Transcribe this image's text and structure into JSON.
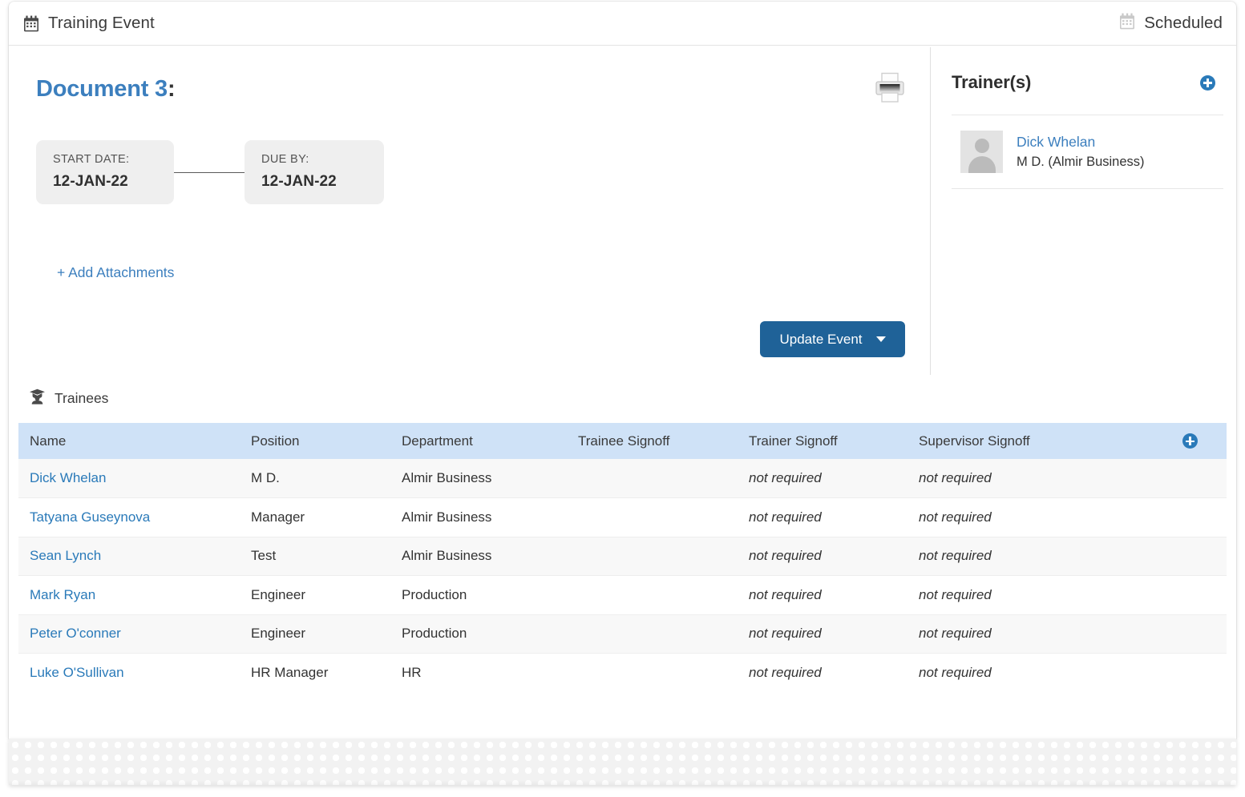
{
  "topbar": {
    "icon": "calendar-icon",
    "title": "Training Event",
    "status_icon": "calendar-icon",
    "status": "Scheduled"
  },
  "main": {
    "document_title": "Document 3",
    "document_title_colon": ":",
    "print_icon": "printer-icon",
    "start_date": {
      "label": "START DATE:",
      "value": "12-JAN-22"
    },
    "due_by": {
      "label": "DUE BY:",
      "value": "12-JAN-22"
    },
    "add_attachments": "+ Add Attachments",
    "update_button": "Update Event"
  },
  "trainers": {
    "title": "Trainer(s)",
    "add_icon": "plus-circle-icon",
    "people": [
      {
        "name": "Dick Whelan",
        "role": "M D. (Almir Business)",
        "avatar": "person-avatar"
      }
    ]
  },
  "trainees": {
    "icon": "graduate-person-icon",
    "label": "Trainees",
    "add_icon": "plus-circle-icon",
    "columns": [
      "Name",
      "Position",
      "Department",
      "Trainee Signoff",
      "Trainer Signoff",
      "Supervisor Signoff",
      ""
    ],
    "rows": [
      {
        "name": "Dick Whelan",
        "position": "M D.",
        "department": "Almir Business",
        "trainee_signoff": "",
        "trainer_signoff": "not required",
        "supervisor_signoff": "not required"
      },
      {
        "name": "Tatyana Guseynova",
        "position": "Manager",
        "department": "Almir Business",
        "trainee_signoff": "",
        "trainer_signoff": "not required",
        "supervisor_signoff": "not required"
      },
      {
        "name": "Sean Lynch",
        "position": "Test",
        "department": "Almir Business",
        "trainee_signoff": "",
        "trainer_signoff": "not required",
        "supervisor_signoff": "not required"
      },
      {
        "name": "Mark Ryan",
        "position": "Engineer",
        "department": "Production",
        "trainee_signoff": "",
        "trainer_signoff": "not required",
        "supervisor_signoff": "not required"
      },
      {
        "name": "Peter O'conner",
        "position": "Engineer",
        "department": "Production",
        "trainee_signoff": "",
        "trainer_signoff": "not required",
        "supervisor_signoff": "not required"
      },
      {
        "name": "Luke O'Sullivan",
        "position": "HR Manager",
        "department": "HR",
        "trainee_signoff": "",
        "trainer_signoff": "not required",
        "supervisor_signoff": "not required"
      }
    ]
  },
  "colors": {
    "link": "#2a7ab9",
    "title": "#3c7fbe",
    "button": "#1f6298",
    "table_header": "#cfe2f7",
    "muted": "#8c8c8c"
  }
}
